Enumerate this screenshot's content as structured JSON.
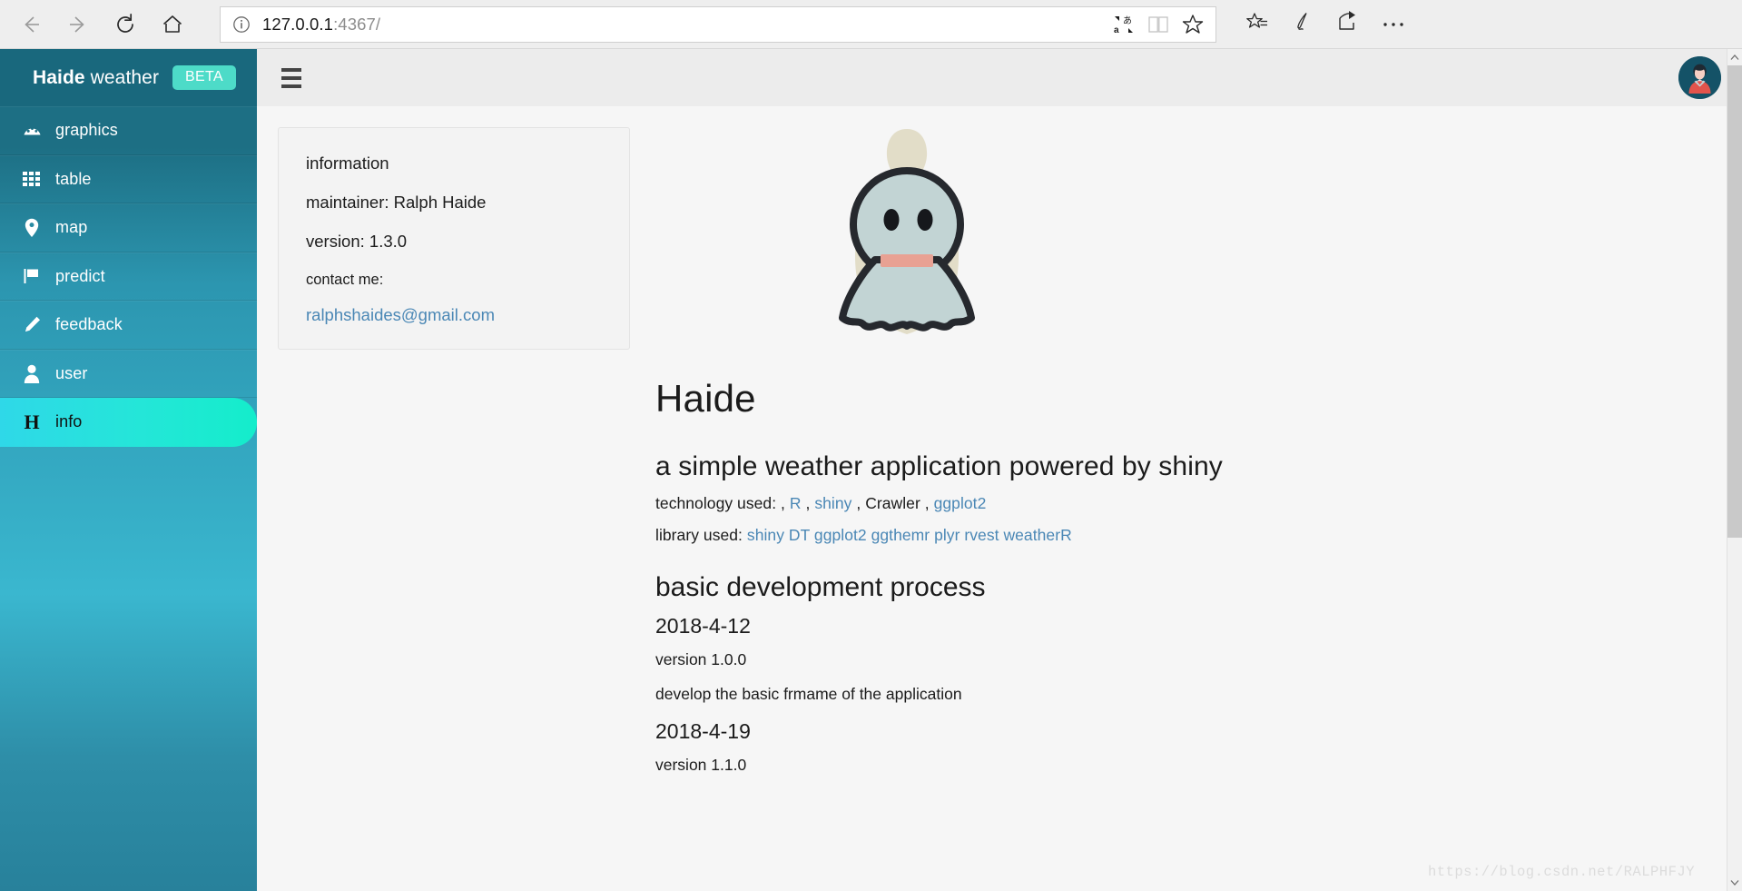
{
  "browser": {
    "back_icon": "arrow-left-icon",
    "forward_icon": "arrow-right-icon",
    "refresh_icon": "refresh-icon",
    "home_icon": "home-icon",
    "site_info_icon": "info-circle-icon",
    "url_host": "127.0.0.1",
    "url_rest": ":4367/",
    "url_full": "127.0.0.1:4367/",
    "translate_icon": "translate-icon",
    "reading_view_icon": "book-icon",
    "favorite_icon": "star-icon",
    "favorites_hub_icon": "star-list-icon",
    "web_notes_icon": "pen-icon",
    "share_icon": "share-icon",
    "more_icon": "ellipsis-icon"
  },
  "sidebar": {
    "brand_bold": "Haide",
    "brand_light": " weather",
    "badge": "BETA",
    "items": [
      {
        "label": "graphics",
        "icon": "dashboard-icon",
        "active": false
      },
      {
        "label": "table",
        "icon": "grid-icon",
        "active": false
      },
      {
        "label": "map",
        "icon": "map-pin-icon",
        "active": false
      },
      {
        "label": "predict",
        "icon": "flag-icon",
        "active": false
      },
      {
        "label": "feedback",
        "icon": "pencil-icon",
        "active": false
      },
      {
        "label": "user",
        "icon": "user-icon",
        "active": false
      },
      {
        "label": "info",
        "icon": "H",
        "active": true
      }
    ]
  },
  "topbar": {
    "menu_toggle_icon": "hamburger-icon",
    "avatar_icon": "avatar"
  },
  "info_card": {
    "heading": "information",
    "maintainer": "maintainer: Ralph Haide",
    "version": "version: 1.3.0",
    "contact_label": "contact me:",
    "email": "ralphshaides@gmail.com"
  },
  "article": {
    "mascot_icon": "teru-teru-bozu-mascot",
    "title": "Haide",
    "subtitle": "a simple weather application powered by shiny",
    "technology_label": "technology used: ,",
    "technology_items": [
      "R",
      ",",
      "shiny",
      ", Crawler ,",
      "ggplot2"
    ],
    "technology_line": "technology used: , R , shiny , Crawler , ggplot2",
    "library_label": "library used:",
    "library_line": "library used: shiny DT ggplot2 ggthemr plyr rvest weatherR",
    "library_items": "shiny DT ggplot2 ggthemr plyr rvest weatherR",
    "process_heading": "basic development process",
    "entries": [
      {
        "date": "2018-4-12",
        "version": "version 1.0.0",
        "note": "develop the basic frmame of the application"
      },
      {
        "date": "2018-4-19",
        "version": "version 1.1.0",
        "note": ""
      }
    ]
  },
  "watermark": "https://blog.csdn.net/RALPHFJY",
  "colors": {
    "sidebar_top": "#1d6f84",
    "brand_bar": "#19687d",
    "badge": "#4ddbc8",
    "active_gradient_start": "#2fd8e8",
    "active_gradient_end": "#14edcb",
    "link": "#4a87b5",
    "avatar_bg": "#145267"
  }
}
